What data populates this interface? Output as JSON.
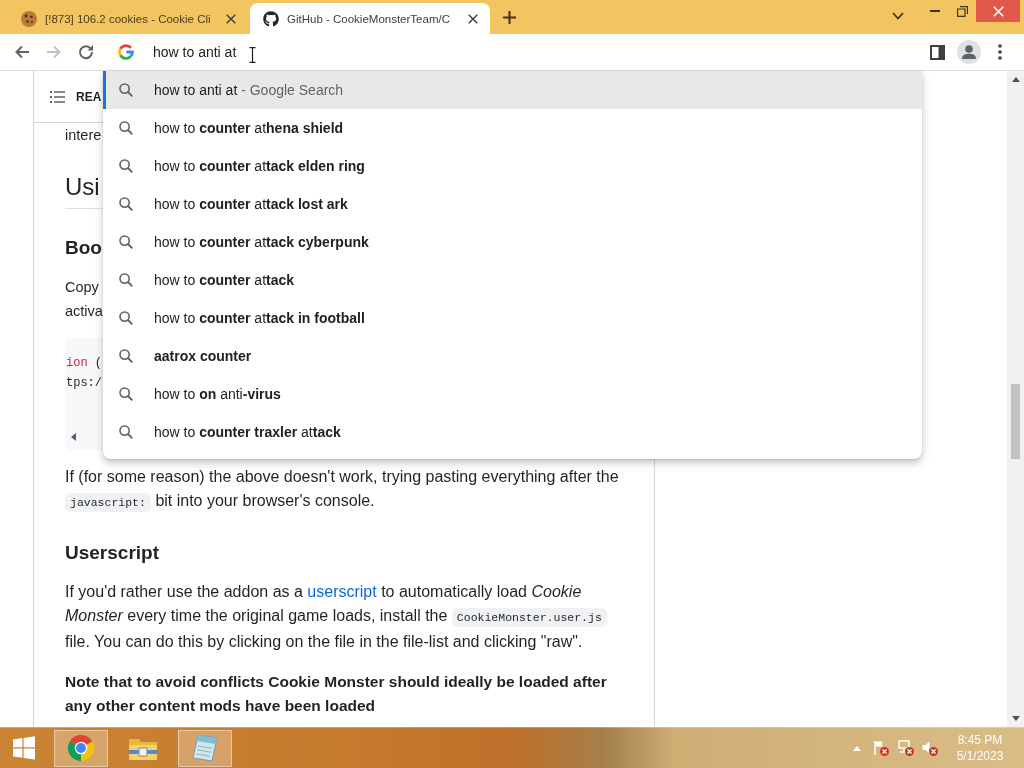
{
  "tabs": [
    {
      "kind": "cookie",
      "title": "[!873] 106.2 cookies - Cookie Cli",
      "selected": false
    },
    {
      "kind": "github",
      "title": "GitHub - CookieMonsterTeam/C",
      "selected": true
    }
  ],
  "toolbar": {
    "nav_buttons": [
      {
        "kind": "back",
        "disabled": false
      },
      {
        "kind": "forward",
        "disabled": true
      },
      {
        "kind": "reload",
        "disabled": false
      }
    ],
    "omnibox": {
      "value": "how to anti at"
    }
  },
  "suggestions": [
    {
      "text": "how to anti at",
      "suffix": "- Google Search",
      "selected": true
    },
    {
      "text": "how to **counter** at**hena shield**",
      "selected": false
    },
    {
      "text": "how to **counter** at**tack elden ring**",
      "selected": false
    },
    {
      "text": "how to **counter** at**tack lost ark**",
      "selected": false
    },
    {
      "text": "how to **counter** at**tack cyberpunk**",
      "selected": false
    },
    {
      "text": "how to **counter** at**tack**",
      "selected": false
    },
    {
      "text": "how to **counter** at**tack in football**",
      "selected": false
    },
    {
      "text": "**aatrox counter**",
      "selected": false
    },
    {
      "text": "how to **on** anti**-virus**",
      "selected": false
    },
    {
      "text": "how to **counter traxler** at**tack**",
      "selected": false
    }
  ],
  "readme": {
    "title": "REA",
    "covered": {
      "lead": "intere",
      "heading": "Usi",
      "subheading": "Boo",
      "paragraph_lines": [
        "Copy",
        "activa"
      ],
      "code_lines": [
        {
          "tokens": [
            {
              "kind": "keyword",
              "text": "ion"
            },
            {
              "kind": "plain",
              "text": " ("
            }
          ]
        },
        {
          "tokens": [
            {
              "kind": "plain",
              "text": "tps:/"
            }
          ]
        }
      ]
    },
    "blocks": [
      {
        "kind": "paragraph",
        "segments": [
          {
            "kind": "text",
            "text": "If (for some reason) the above doesn't work, trying pasting everything after the"
          },
          {
            "kind": "code",
            "text": "javascript:"
          },
          {
            "kind": "text",
            "text": "bit into your browser's console."
          }
        ]
      },
      {
        "kind": "heading",
        "text": "Userscript"
      },
      {
        "kind": "paragraph",
        "segments": [
          {
            "kind": "text",
            "text": "If you'd rather use the addon as a"
          },
          {
            "kind": "link",
            "text": "userscript"
          },
          {
            "kind": "text",
            "text": "to automatically load *Cookie Monster* every time the original game loads, install the"
          },
          {
            "kind": "code",
            "text": "CookieMonster.user.js"
          },
          {
            "kind": "text",
            "text": "file. You can do this by clicking on the file in the file-list and clicking \"raw\"."
          }
        ]
      },
      {
        "kind": "note",
        "text": "Note that to avoid conflicts Cookie Monster should ideally be loaded after any other content mods have been loaded"
      }
    ]
  },
  "taskbar": {
    "apps": [
      {
        "kind": "chrome",
        "running": true
      },
      {
        "kind": "explorer",
        "running": false
      },
      {
        "kind": "notepad",
        "running": true
      }
    ],
    "clock": {
      "time": "8:45 PM",
      "date": "5/1/2023"
    }
  }
}
